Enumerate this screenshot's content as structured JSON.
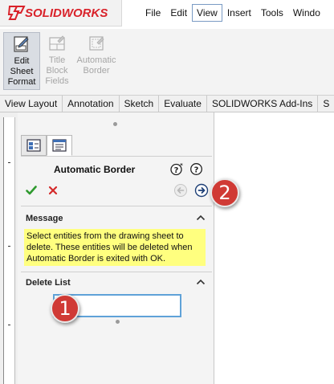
{
  "app": {
    "brand": "SOLIDWORKS",
    "brand_color": "#d9222a"
  },
  "menu": {
    "items": [
      "File",
      "Edit",
      "View",
      "Insert",
      "Tools",
      "Windo"
    ],
    "active": "View"
  },
  "ribbon": {
    "edit_sheet_format": "Edit Sheet Format",
    "title_block_fields": "Title Block Fields",
    "automatic_border": "Automatic Border"
  },
  "tabs": [
    "View Layout",
    "Annotation",
    "Sketch",
    "Evaluate",
    "SOLIDWORKS Add-Ins",
    "S"
  ],
  "property_manager": {
    "title": "Automatic Border",
    "message_group": {
      "title": "Message",
      "text": "Select entities from the drawing sheet to delete. These entities will be deleted when Automatic Border is exited with OK."
    },
    "delete_list_group": {
      "title": "Delete List",
      "value": ""
    }
  },
  "callouts": {
    "first": "1",
    "second": "2",
    "color": "#d03a35"
  },
  "icons": [
    "solidworks-logo-icon",
    "edit-sheet-format-icon",
    "title-block-fields-icon",
    "automatic-border-icon",
    "feature-manager-icon",
    "property-manager-icon",
    "help-icon",
    "whats-wrong-icon",
    "ok-check-icon",
    "cancel-x-icon",
    "back-arrow-icon",
    "next-arrow-icon",
    "collapse-chevron-icon"
  ]
}
